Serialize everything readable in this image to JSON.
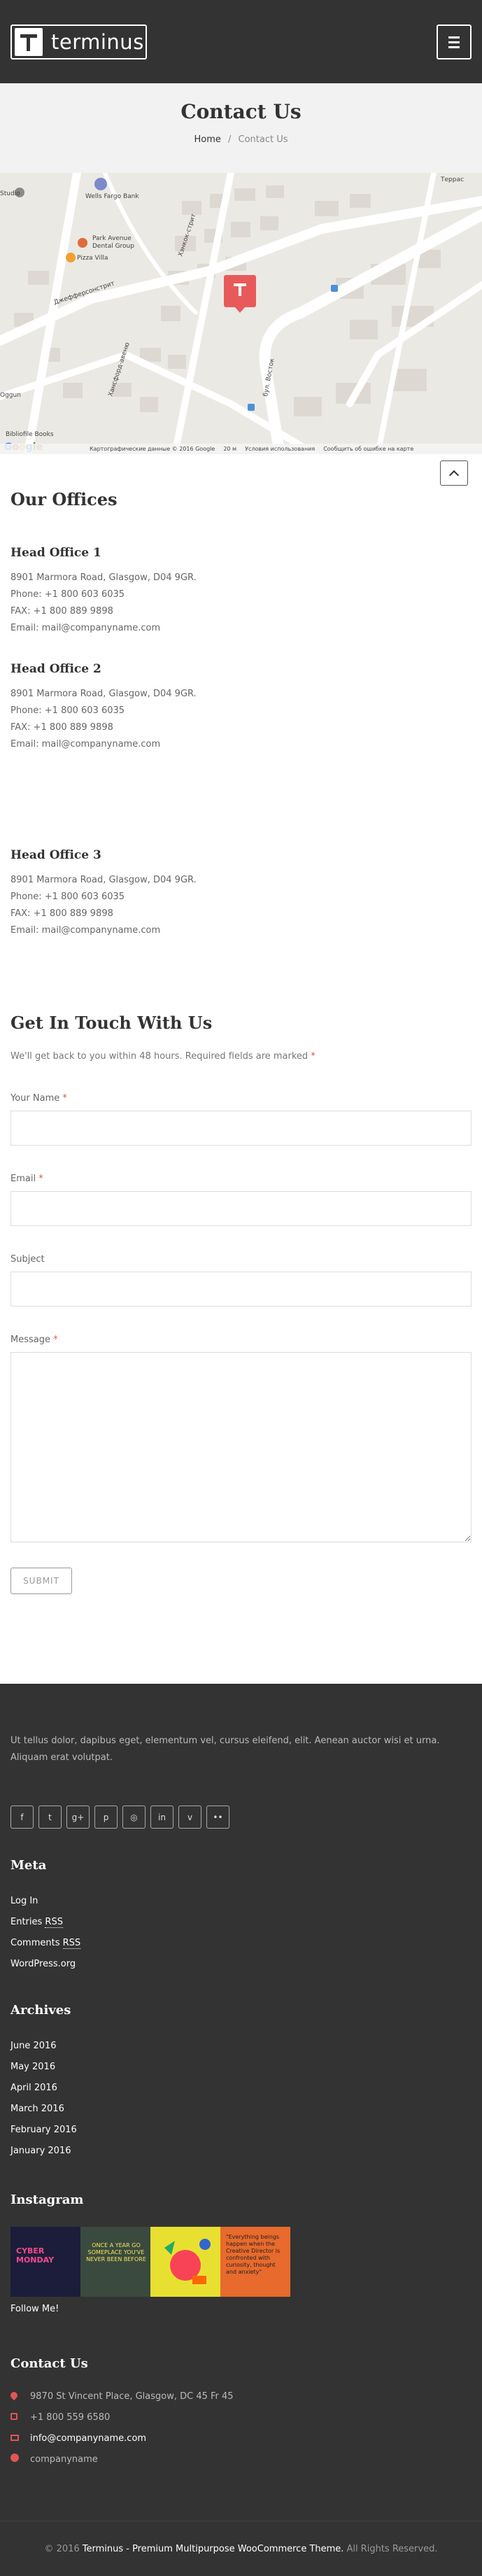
{
  "header": {
    "logo_text": "terminus",
    "menu_icon": "hamburger-icon"
  },
  "title_band": {
    "title": "Contact Us",
    "breadcrumb": {
      "home": "Home",
      "separator": "/",
      "current": "Contact Us"
    }
  },
  "map": {
    "labels": {
      "studio": "Studio",
      "wells_fargo": "Wells Fargo Bank",
      "park_avenue": "Park Avenue",
      "dental_group": "Dental Group",
      "pizza_villa": "Pizza Villa",
      "street_jefferson": "Джефферсонстрит",
      "street_hansford": "Хансфорд-авеню",
      "street_hancock": "Хэнкок-стрит",
      "street_east": "бул. Восток",
      "street_terrace": "Террас",
      "bibliofile": "Bibliofile Books",
      "oggun": "Oggun"
    },
    "footer": {
      "data": "Картографические данные © 2016 Google",
      "scale": "20 м",
      "terms": "Условия использования",
      "report": "Сообщить об ошибке на карте"
    },
    "google_logo": [
      "G",
      "o",
      "o",
      "g",
      "l",
      "e"
    ],
    "pin_color": "#e85a5a"
  },
  "offices": {
    "title": "Our Offices",
    "items": [
      {
        "name": "Head Office 1",
        "address": "8901 Marmora Road, Glasgow, D04 9GR.",
        "phone": "Phone: +1 800 603 6035",
        "fax": "FAX: +1 800 889 9898",
        "email": "Email: mail@companyname.com"
      },
      {
        "name": "Head Office 2",
        "address": "8901 Marmora Road, Glasgow, D04 9GR.",
        "phone": "Phone: +1 800 603 6035",
        "fax": "FAX: +1 800 889 9898",
        "email": "Email: mail@companyname.com"
      },
      {
        "name": "Head Office 3",
        "address": "8901 Marmora Road, Glasgow, D04 9GR.",
        "phone": "Phone: +1 800 603 6035",
        "fax": "FAX: +1 800 889 9898",
        "email": "Email: mail@companyname.com"
      }
    ]
  },
  "contact_form": {
    "title": "Get In Touch With Us",
    "intro": "We'll get back to you within 48 hours. Required fields are marked",
    "required_mark": "*",
    "name_label": "Your Name",
    "email_label": "Email",
    "subject_label": "Subject",
    "message_label": "Message",
    "submit_label": "SUBMIT"
  },
  "footer": {
    "about": "Ut tellus dolor, dapibus eget, elementum vel, cursus eleifend, elit. Aenean auctor wisi et urna. Aliquam erat volutpat.",
    "social_icons": [
      "facebook-icon",
      "twitter-icon",
      "google-plus-icon",
      "pinterest-icon",
      "instagram-icon",
      "linkedin-icon",
      "vimeo-icon",
      "flickr-icon"
    ],
    "social_glyphs": [
      "f",
      "t",
      "g+",
      "p",
      "◎",
      "in",
      "v",
      "••"
    ],
    "meta": {
      "title": "Meta",
      "log_in": "Log In",
      "entries_prefix": "Entries",
      "comments_prefix": "Comments",
      "rss": "RSS",
      "wordpress": "WordPress.org"
    },
    "archives": {
      "title": "Archives",
      "items": [
        "June 2016",
        "May 2016",
        "April 2016",
        "March 2016",
        "February 2016",
        "January 2016"
      ]
    },
    "instagram": {
      "title": "Instagram",
      "tiles": [
        "CYBER MONDAY",
        "ONCE A YEAR GO SOMEPLACE YOU'VE NEVER BEEN BEFORE",
        "",
        "\"Everything beings happen when the Creative Director is confronted with curiosity, thought and anxiety\""
      ],
      "follow": "Follow Me!"
    },
    "contact": {
      "title": "Contact Us",
      "address": "9870 St Vincent Place, Glasgow, DC 45 Fr 45",
      "phone": "+1 800 559 6580",
      "email": "info@companyname.com",
      "skype": "companyname"
    },
    "copyright": {
      "year": "© 2016",
      "theme": "Terminus - Premium Multipurpose WooCommerce Theme.",
      "rights": "All Rights Reserved."
    }
  }
}
